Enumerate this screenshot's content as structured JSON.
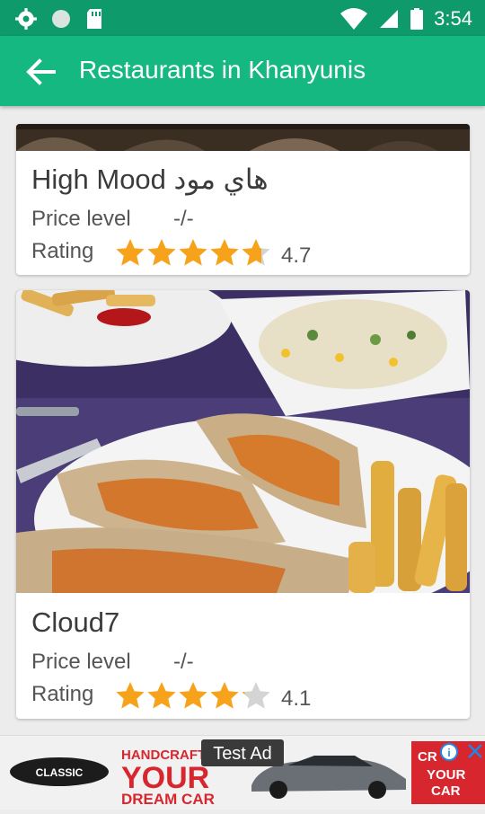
{
  "status_bar": {
    "time": "3:54",
    "icons": [
      "gear-icon",
      "circle-icon",
      "sd-card-icon",
      "wifi-icon",
      "signal-icon",
      "battery-icon"
    ]
  },
  "app_bar": {
    "title": "Restaurants in Khanyunis",
    "back_icon": "arrow-left-icon"
  },
  "restaurants": [
    {
      "name": "High Mood هاي مود",
      "price_label": "Price level",
      "price_value": "-/-",
      "rating_label": "Rating",
      "rating": 4.7,
      "rating_text": "4.7"
    },
    {
      "name": "Cloud7",
      "price_label": "Price level",
      "price_value": "-/-",
      "rating_label": "Rating",
      "rating": 4.1,
      "rating_text": "4.1"
    }
  ],
  "ad": {
    "tag": "Test Ad",
    "brand": "CLASSIC",
    "headline_1": "HANDCRAFT",
    "headline_2": "YOUR",
    "headline_3": "DREAM CAR",
    "side_1": "CR",
    "side_2": "YOUR",
    "side_3": "CAR"
  },
  "colors": {
    "status_bar": "#0e9a6a",
    "app_bar": "#16b882",
    "star_filled": "#f7a21b",
    "star_empty": "#d4d4d4",
    "ad_red": "#d8262e"
  }
}
